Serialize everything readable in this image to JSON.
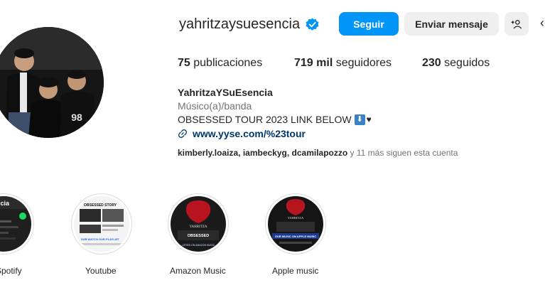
{
  "profile": {
    "username": "yahritzaysuesencia",
    "verified_icon": "verified-badge-icon",
    "accent_color": "#0095f6"
  },
  "actions": {
    "follow_label": "Seguir",
    "message_label": "Enviar mensaje",
    "add_user_icon": "add-user-icon",
    "more_icon": "chevron-icon"
  },
  "stats": {
    "posts_count": "75",
    "posts_label": "publicaciones",
    "followers_count": "719 mil",
    "followers_label": "seguidores",
    "following_count": "230",
    "following_label": "seguidos"
  },
  "bio": {
    "name": "YahritzaYSuEsencia",
    "category": "Músico(a)/banda",
    "text": "OBSESSED TOUR 2023 LINK BELOW",
    "emoji_down": "⬇",
    "emoji_heart": "♥",
    "link": "www.yyse.com/%23tour"
  },
  "mutual": {
    "names": "kimberly.loaiza, iambeckyg, dcamilapozzo",
    "suffix": " y 11 más siguen esta cuenta"
  },
  "highlights": [
    {
      "label": "Spotify"
    },
    {
      "label": "Youtube",
      "thumb_title": "OBSESSED STORY",
      "thumb_caption": "SUB WATCH OUR PLAYLIST"
    },
    {
      "label": "Amazon Music",
      "thumb_title": "YAHRITZA",
      "thumb_subtitle": "OBSESSED",
      "thumb_caption": "LISTEN ON AMAZON MUSIC"
    },
    {
      "label": "Apple music",
      "thumb_title": "YAHRITZA",
      "thumb_caption": "OUR MUSIC ON APPLE MUSIC"
    }
  ],
  "spotify_thumb": {
    "fragment": "encia"
  }
}
